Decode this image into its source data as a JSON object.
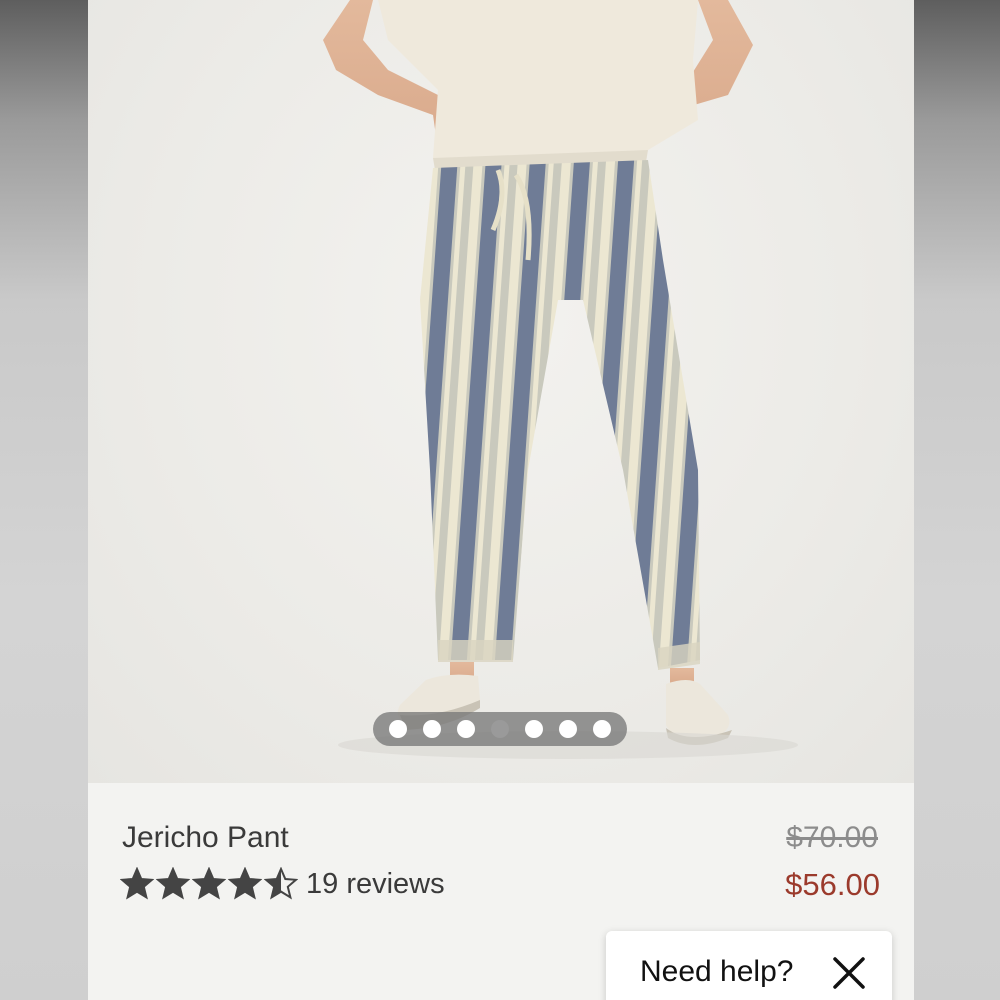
{
  "product": {
    "name": "Jericho Pant",
    "original_price": "$70.00",
    "sale_price": "$56.00",
    "rating": 4.5,
    "rating_max": 5,
    "reviews_label": "19 reviews"
  },
  "carousel": {
    "total": 7,
    "active_index": 3
  },
  "help": {
    "label": "Need help?",
    "close_icon": "close-icon"
  },
  "colors": {
    "sale": "#9b3a2c",
    "text": "#3a3a3a",
    "strike": "#8c8c8c",
    "stripe_blue": "#6f7c96",
    "stripe_cream": "#e9e4cf"
  }
}
